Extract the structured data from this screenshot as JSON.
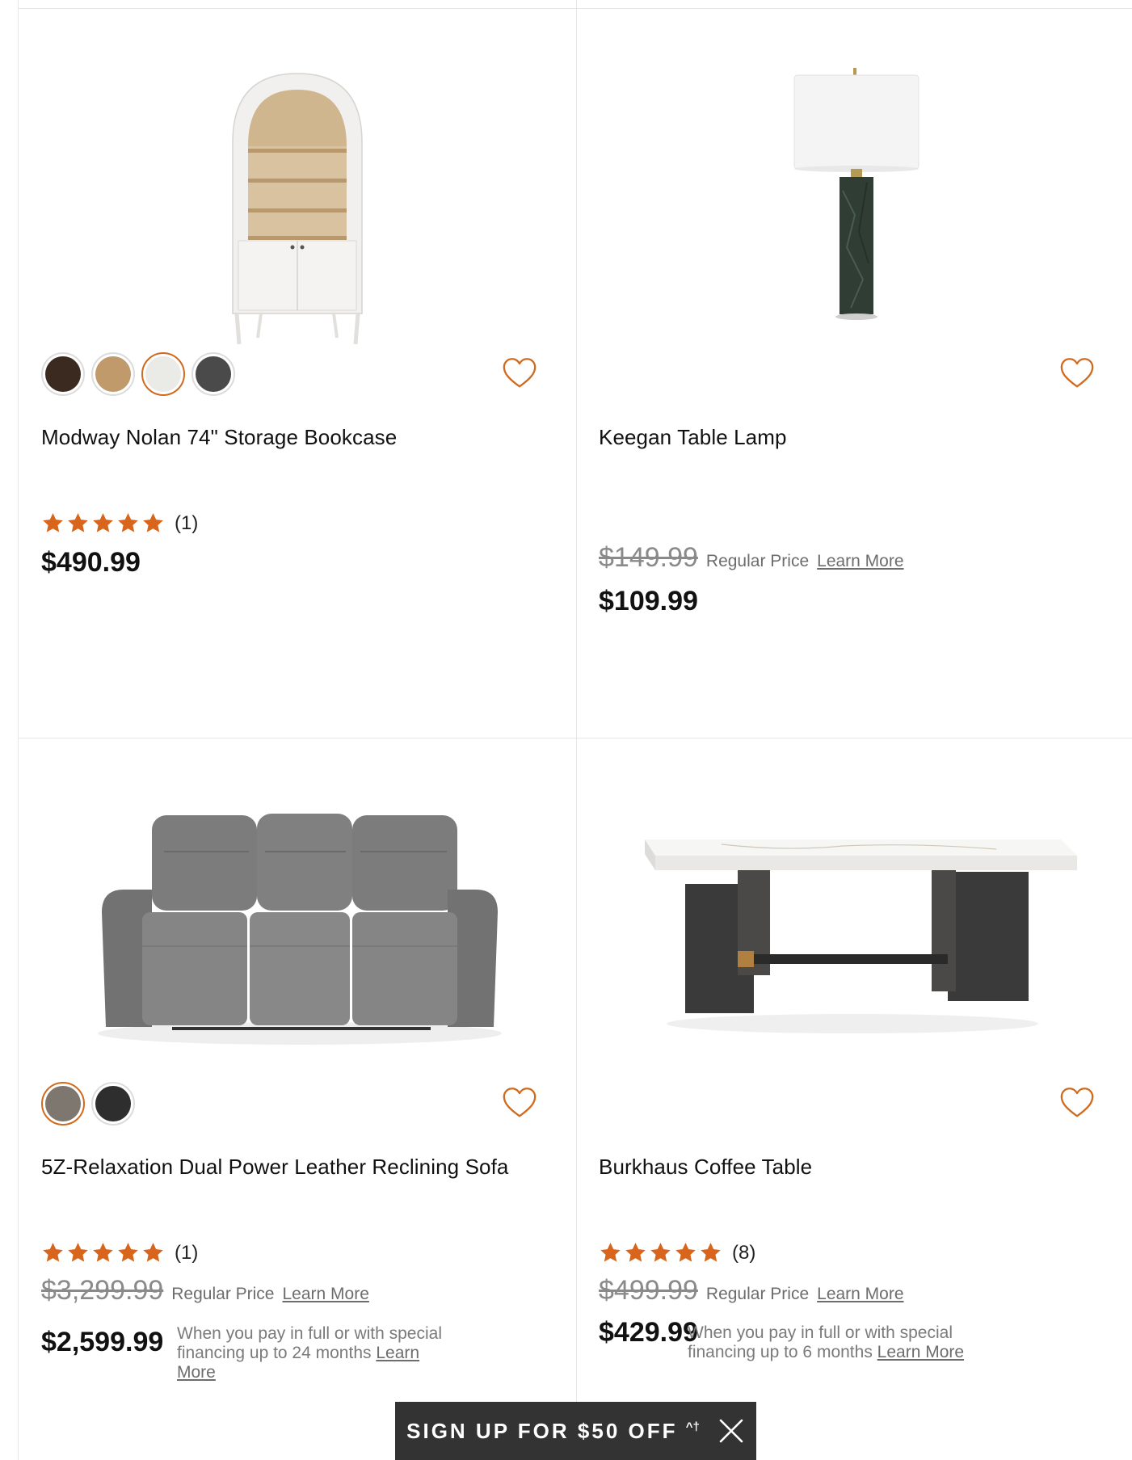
{
  "colors": {
    "accent": "#d06a1e",
    "star": "#d8651b",
    "banner_bg": "#333333",
    "muted": "#7a7a7a"
  },
  "products": [
    {
      "name": "Modway Nolan 74\" Storage Bookcase",
      "image": "arched-white-bookcase-image",
      "swatches": [
        {
          "color": "#3b2a20",
          "selected": false
        },
        {
          "color": "#c19a6b",
          "selected": false
        },
        {
          "color": "#eaeae6",
          "selected": true
        },
        {
          "color": "#4a4a4a",
          "selected": false
        }
      ],
      "rating": 5,
      "review_count": "(1)",
      "price": "$490.99"
    },
    {
      "name": "Keegan Table Lamp",
      "image": "green-marble-table-lamp-image",
      "swatches": [],
      "regular_price": "$149.99",
      "regular_label": "Regular Price",
      "learn_more": "Learn More",
      "price": "$109.99"
    },
    {
      "name": "5Z-Relaxation Dual Power Leather Reclining Sofa",
      "image": "gray-leather-reclining-sofa-image",
      "swatches": [
        {
          "color": "#7d7770",
          "selected": true
        },
        {
          "color": "#2f2e2f",
          "selected": false
        }
      ],
      "rating": 5,
      "review_count": "(1)",
      "regular_price": "$3,299.99",
      "regular_label": "Regular Price",
      "learn_more": "Learn More",
      "price": "$2,599.99",
      "financing_text": "When you pay in full or with special financing up to 24 months",
      "financing_line1": "When you pay in full or with special",
      "financing_line2": "financing up to 24 months",
      "financing_learn": "Learn",
      "financing_learn2": "More"
    },
    {
      "name": "Burkhaus Coffee Table",
      "image": "marble-top-coffee-table-image",
      "swatches": [],
      "rating": 5,
      "review_count": "(8)",
      "regular_price": "$499.99",
      "regular_label": "Regular Price",
      "learn_more": "Learn More",
      "price": "$429.99",
      "financing_line1": "When you pay in full or with special",
      "financing_line2": "financing up to 6 months",
      "financing_learn": "Learn More"
    }
  ],
  "banner": {
    "text": "SIGN UP FOR $50 OFF",
    "superscript": "^†",
    "close_icon": "close-icon"
  }
}
